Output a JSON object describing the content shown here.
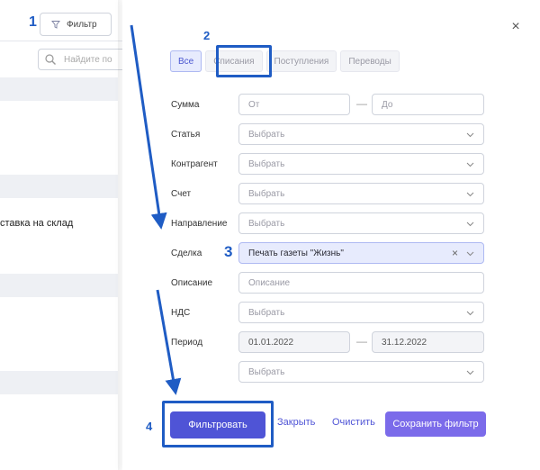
{
  "background": {
    "filter_button_label": "Фильтр",
    "search_placeholder": "Найдите по",
    "row_text": "ставка на склад"
  },
  "drawer": {
    "close_glyph": "×",
    "tabs": [
      {
        "label": "Все",
        "active": true
      },
      {
        "label": "Списания",
        "active": false
      },
      {
        "label": "Поступления",
        "active": false
      },
      {
        "label": "Переводы",
        "active": false
      }
    ],
    "fields": {
      "sum": {
        "label": "Сумма",
        "from_placeholder": "От",
        "to_placeholder": "До",
        "dash": "—"
      },
      "article": {
        "label": "Статья",
        "value": "Выбрать"
      },
      "counterparty": {
        "label": "Контрагент",
        "value": "Выбрать"
      },
      "account": {
        "label": "Счет",
        "value": "Выбрать"
      },
      "direction": {
        "label": "Направление",
        "value": "Выбрать"
      },
      "deal": {
        "label": "Сделка",
        "value": "Печать газеты \"Жизнь\"",
        "clear": "×"
      },
      "description": {
        "label": "Описание",
        "placeholder": "Описание"
      },
      "vat": {
        "label": "НДС",
        "value": "Выбрать"
      },
      "period": {
        "label": "Период",
        "from": "01.01.2022",
        "to": "31.12.2022",
        "dash": "—"
      },
      "extra": {
        "value": "Выбрать"
      }
    },
    "buttons": {
      "filter": "Фильтровать",
      "close": "Закрыть",
      "clear": "Очистить",
      "save": "Сохранить фильтр"
    }
  },
  "annotations": {
    "step1": "1",
    "step2": "2",
    "step3": "3",
    "step4": "4",
    "color": "#1f5cc4"
  },
  "colors": {
    "primary": "#4f54d6",
    "save_button": "#7b6bea",
    "selected_fill": "#e7ebfd"
  }
}
